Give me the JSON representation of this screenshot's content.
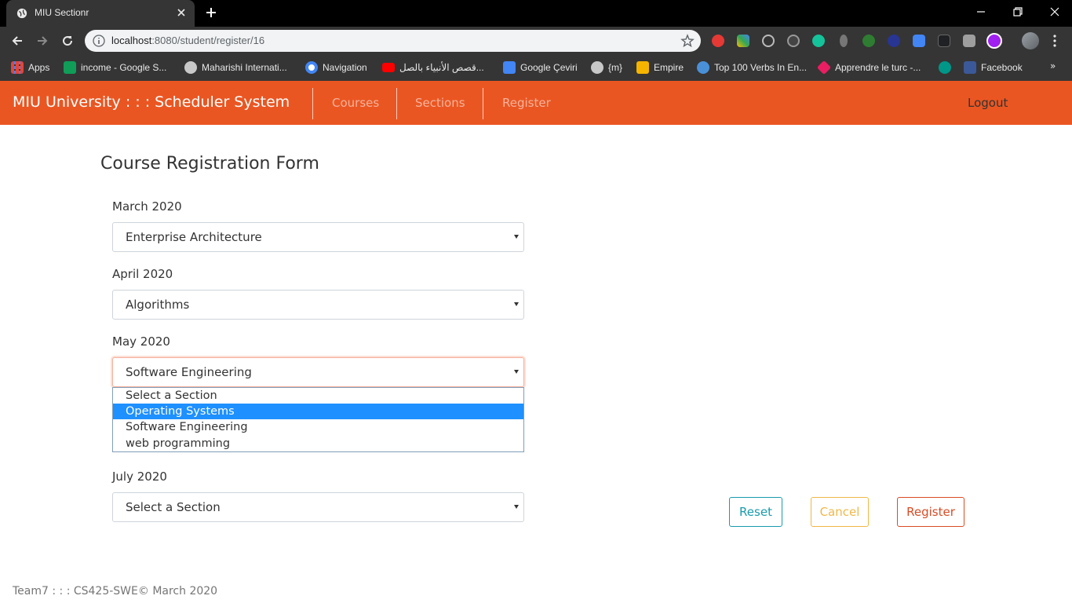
{
  "browser": {
    "tab_title": "MIU Sectionr",
    "url_host": "localhost",
    "url_path": ":8080/student/register/16",
    "bookmarks": [
      {
        "label": "Apps",
        "icon": "apps-grid-icon",
        "color": "#ea4335"
      },
      {
        "label": "income - Google S...",
        "icon": "google-sheets-icon",
        "color": "#0f9d58"
      },
      {
        "label": "Maharishi Internati...",
        "icon": "globe-icon",
        "color": "#9aa0a6"
      },
      {
        "label": "Navigation",
        "icon": "navigation-icon",
        "color": "#4285f4"
      },
      {
        "label": "قصص الأنبياء بالصل...",
        "icon": "youtube-icon",
        "color": "#ff0000"
      },
      {
        "label": "Google Çeviri",
        "icon": "google-translate-icon",
        "color": "#4285f4"
      },
      {
        "label": "{m}",
        "icon": "globe-icon",
        "color": "#9aa0a6"
      },
      {
        "label": "Empire",
        "icon": "empire-icon",
        "color": "#f4b400"
      },
      {
        "label": "Top 100 Verbs In En...",
        "icon": "bookmark-icon",
        "color": "#4a90d9"
      },
      {
        "label": "Apprendre le turc -...",
        "icon": "site-icon",
        "color": "#e91e63"
      },
      {
        "label": "",
        "icon": "site-icon",
        "color": "#009688"
      },
      {
        "label": "Facebook",
        "icon": "facebook-icon",
        "color": "#3b5998"
      }
    ],
    "more_bookmarks": "»"
  },
  "navbar": {
    "brand": "MIU University : : : Scheduler System",
    "links": [
      "Courses",
      "Sections",
      "Register"
    ],
    "logout": "Logout",
    "color": "#ea5622"
  },
  "form": {
    "title": "Course Registration Form",
    "fields": [
      {
        "label": "March 2020",
        "value": "Enterprise Architecture"
      },
      {
        "label": "April 2020",
        "value": "Algorithms"
      },
      {
        "label": "May 2020",
        "value": "Software Engineering"
      },
      {
        "label": "July 2020",
        "value": "Select a Section"
      }
    ],
    "dropdown_options": [
      "Select a Section",
      "Operating Systems",
      "Software Engineering",
      "web programming"
    ],
    "dropdown_highlighted": "Operating Systems",
    "buttons": {
      "reset": "Reset",
      "cancel": "Cancel",
      "register": "Register"
    }
  },
  "footer": "Team7 : : : CS425-SWE© March 2020"
}
